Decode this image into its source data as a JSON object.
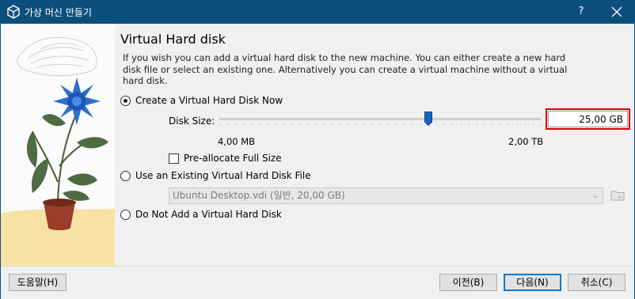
{
  "window": {
    "title": "가상 머신 만들기",
    "help_label": "?"
  },
  "page": {
    "heading": "Virtual Hard disk",
    "description": "If you wish you can add a virtual hard disk to the new machine. You can either create a new hard disk file or select an existing one. Alternatively you can create a virtual machine without a virtual hard disk."
  },
  "options": {
    "create_new": {
      "label": "Create a Virtual Hard Disk Now",
      "checked": true
    },
    "use_existing": {
      "label": "Use an Existing Virtual Hard Disk File",
      "checked": false
    },
    "no_disk": {
      "label": "Do Not Add a Virtual Hard Disk",
      "checked": false
    }
  },
  "disk_size": {
    "label": "Disk Size:",
    "value": "25,00 GB",
    "min_label": "4,00 MB",
    "max_label": "2,00 TB",
    "slider_fraction": 0.65
  },
  "preallocate": {
    "label": "Pre-allocate Full Size",
    "checked": false
  },
  "existing_file": {
    "selected": "Ubuntu Desktop.vdi (일반, 20,00 GB)"
  },
  "buttons": {
    "help": "도움말(H)",
    "back": "이전(B)",
    "next": "다음(N)",
    "cancel": "취소(C)"
  },
  "colors": {
    "titlebar": "#0d4f7c",
    "accent": "#0078d7",
    "highlight_border": "#e10000",
    "slider_thumb": "#1565c0"
  }
}
